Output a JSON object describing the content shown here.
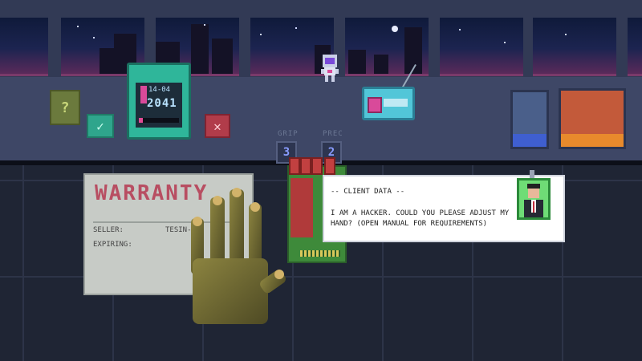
{
  "calendar": {
    "date": "14-04",
    "year": "2041",
    "progress": 0.1
  },
  "buttons": {
    "help": "?",
    "accept": "✓",
    "reject": "✕"
  },
  "stats": [
    {
      "label": "GRIP",
      "value": "3"
    },
    {
      "label": "PREC",
      "value": "2"
    }
  ],
  "warranty": {
    "title": "WARRANTY",
    "seller_label": "SELLER:",
    "seller_value": "TESIN-",
    "expiring_label": "EXPIRING:"
  },
  "client": {
    "header": "-- CLIENT DATA --",
    "message": "I AM A HACKER. COULD YOU PLEASE ADJUST MY HAND? (OPEN MANUAL FOR REQUIREMENTS)"
  },
  "colors": {
    "accent_pink": "#e34a95",
    "accent_teal": "#2fb69a",
    "warranty_red": "#b84e62"
  }
}
